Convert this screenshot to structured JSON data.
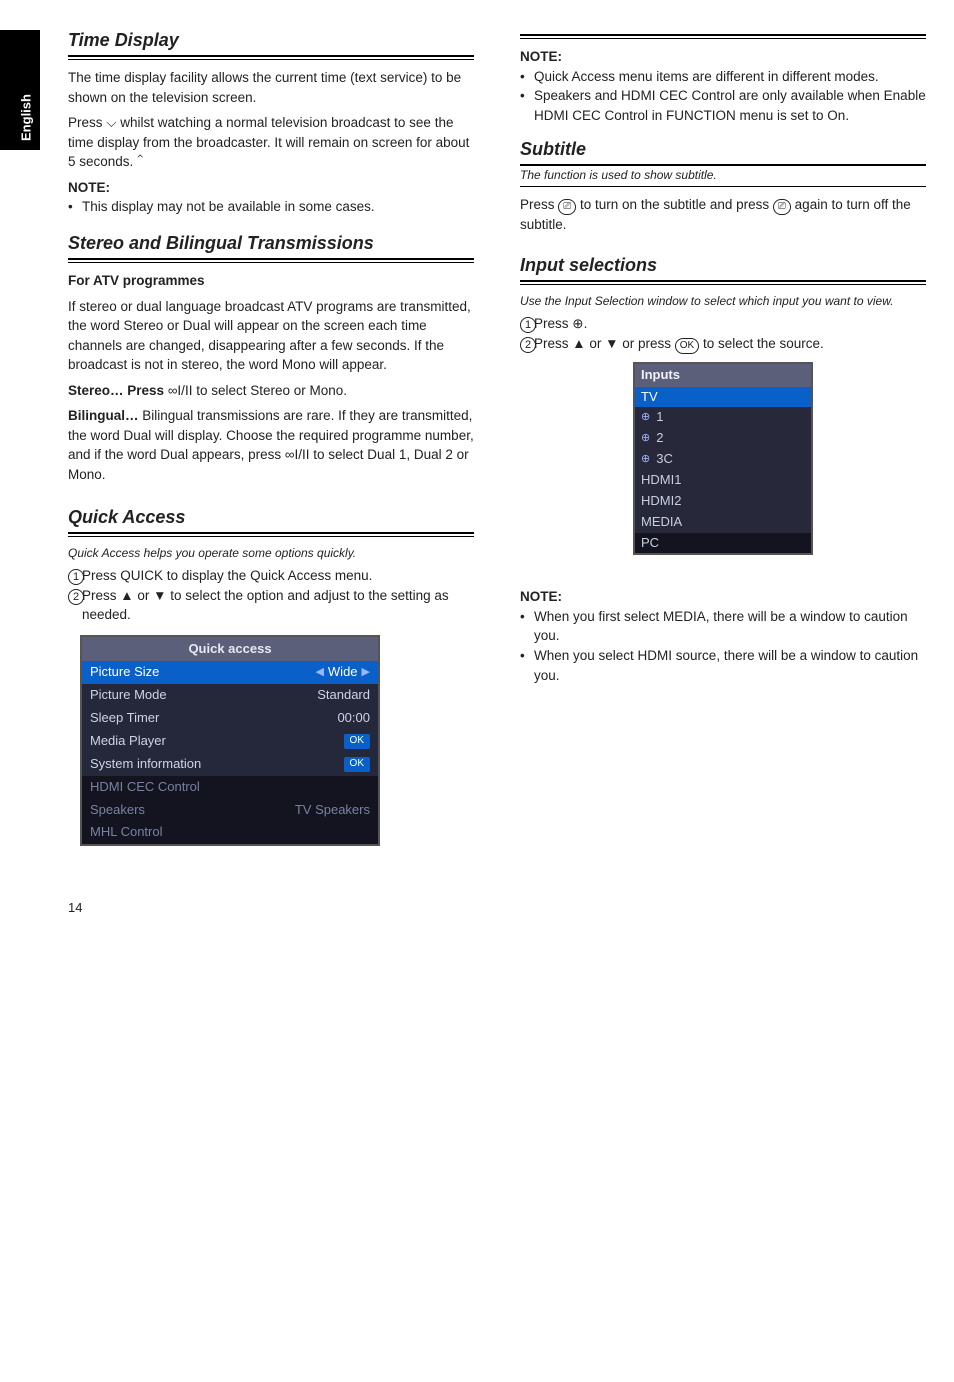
{
  "page_number": "14",
  "side_tab": "English",
  "left": {
    "sec1": {
      "title": "Time Display",
      "p1": "The time display facility allows the current time (text service) to be shown on the television screen.",
      "p2_a": "Press",
      "p2_glyph1": "⌵",
      "p2_mid": " whilst watching a normal television broadcast to see the time display from the broadcaster. It will remain on screen for about 5 seconds. ",
      "p2_glyph2": "⌃",
      "note": "NOTE:",
      "note1": "This display may not be available in some cases."
    },
    "sec2": {
      "title": "Stereo and Bilingual Transmissions",
      "sub_label": "For ATV programmes",
      "p1": "If stereo or dual language broadcast ATV programs are transmitted, the word Stereo or Dual will appear on the screen each time channels are changed, disappearing after a few seconds. If the broadcast is not in stereo, the word Mono will appear.",
      "p2_a": "Stereo… Press ",
      "p2_glyph": "∞I/II",
      "p2_b": " to select Stereo or Mono.",
      "p3_a": "Bilingual… Bilingual transmissions are rare. If they are transmitted, the word Dual will display. Choose the required programme number, and if the word Dual appears, press ",
      "p3_glyph": "∞I/II",
      "p3_b": " to select Dual 1, Dual 2 or Mono."
    },
    "sec3": {
      "title": "Quick Access",
      "intro": "Quick Access helps you operate some options quickly.",
      "steps": [
        "Press QUICK to display the Quick Access menu.",
        "Press ▲ or ▼ to select the option and adjust to the setting as needed."
      ],
      "menu": {
        "title": "Quick access",
        "rows": [
          {
            "label": "Picture Size",
            "value": "Wide",
            "sel": true,
            "arrows": true
          },
          {
            "label": "Picture Mode",
            "value": "Standard"
          },
          {
            "label": "Sleep Timer",
            "value": "00:00"
          },
          {
            "label": "Media Player",
            "value": "OK",
            "pill": true
          },
          {
            "label": "System information",
            "value": "OK",
            "pill": true
          },
          {
            "label": "HDMI CEC Control",
            "value": "",
            "dim": true,
            "dark": true
          },
          {
            "label": "Speakers",
            "value": "TV Speakers",
            "dim": true,
            "dark": true
          },
          {
            "label": "MHL Control",
            "value": "",
            "dim": true,
            "dark": true
          }
        ]
      }
    }
  },
  "right": {
    "sec1": {
      "note_label": "NOTE:",
      "note1": "Quick Access menu items are different in different modes.",
      "note2": "Speakers and HDMI CEC Control are only available when Enable HDMI CEC Control in FUNCTION menu is set to On."
    },
    "sec2": {
      "title": "Subtitle",
      "small_italic": "The function is used to show subtitle.",
      "p_a": "Press ",
      "glyph": "⎚",
      "p_mid": " to turn on the subtitle and press ",
      "p_b": " again to turn off the subtitle."
    },
    "sec3": {
      "title": "Input selections",
      "intro": "Use the Input Selection window to select which input you want to view.",
      "steps": [
        "Press ⊕.",
        "Press ▲ or ▼ or press OK to select the source."
      ],
      "ok_label": "OK",
      "menu": {
        "title": "Inputs",
        "rows": [
          {
            "label": "TV",
            "sel": true
          },
          {
            "label": "1",
            "glyph": true
          },
          {
            "label": "2",
            "glyph": true
          },
          {
            "label": "3C",
            "glyph": true
          },
          {
            "label": "HDMI1"
          },
          {
            "label": "HDMI2"
          },
          {
            "label": "MEDIA"
          },
          {
            "label": "PC",
            "dark": true
          }
        ]
      },
      "note_label": "NOTE:",
      "notes": [
        "When you first select MEDIA, there will be a window to caution you.",
        "When you select HDMI source, there will be a window to caution you."
      ]
    }
  }
}
